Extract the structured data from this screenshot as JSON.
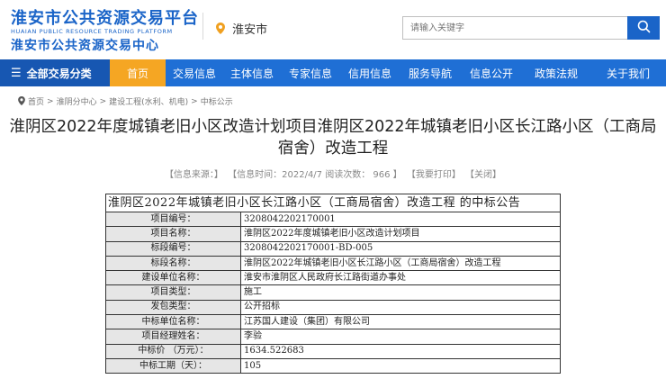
{
  "header": {
    "logo_title": "淮安市公共资源交易平台",
    "logo_en": "HUAIAN PUBLIC RESOURCE TRADING PLATFORM",
    "logo_sub": "淮安市公共资源交易中心",
    "location": "淮安市",
    "location_icon": "map-pin-icon",
    "search_placeholder": "请输入关键字",
    "search_icon": "search-icon"
  },
  "nav": {
    "all_label": "全部交易分类",
    "items": [
      "首页",
      "交易信息",
      "主体信息",
      "专家信息",
      "信用信息",
      "服务导航",
      "信息公开",
      "政策法规",
      "关于我们"
    ],
    "active_index": 0,
    "colors": {
      "bar": "#1f6fd5",
      "all": "#1757b2",
      "active": "#f5a623"
    }
  },
  "breadcrumb": [
    "首页",
    "淮阴分中心",
    "建设工程(水利、机电)",
    "中标公示"
  ],
  "article": {
    "title": "淮阴区2022年度城镇老旧小区改造计划项目淮阴区2022年城镇老旧小区长江路小区（工商局宿舍）改造工程",
    "meta_source": "【信息来源：】",
    "meta_time": "【信息时间：2022/4/7 阅读次数：  966 】",
    "meta_print": "【我要打印】",
    "meta_close": "【关闭】"
  },
  "notice": {
    "heading": "淮阴区2022年城镇老旧小区长江路小区（工商局宿舍）改造工程   的中标公告",
    "rows": [
      {
        "label": "项目编号：",
        "value": "3208042202170001"
      },
      {
        "label": "项目名称：",
        "value": "淮阴区2022年度城镇老旧小区改造计划项目"
      },
      {
        "label": "标段编号：",
        "value": "3208042202170001-BD-005"
      },
      {
        "label": "标段名称：",
        "value": "淮阴区2022年城镇老旧小区长江路小区（工商局宿舍）改造工程"
      },
      {
        "label": "建设单位名称：",
        "value": "淮安市淮阴区人民政府长江路街道办事处"
      },
      {
        "label": "项目类型：",
        "value": "施工"
      },
      {
        "label": "发包类型：",
        "value": "公开招标"
      },
      {
        "label": "中标单位名称：",
        "value": "江苏国人建设（集团）有限公司"
      },
      {
        "label": "项目经理姓名：",
        "value": "李验"
      },
      {
        "label": "中标价  （万元）：",
        "value": "1634.522683"
      },
      {
        "label": "中标工期（天）：",
        "value": "105"
      }
    ]
  }
}
